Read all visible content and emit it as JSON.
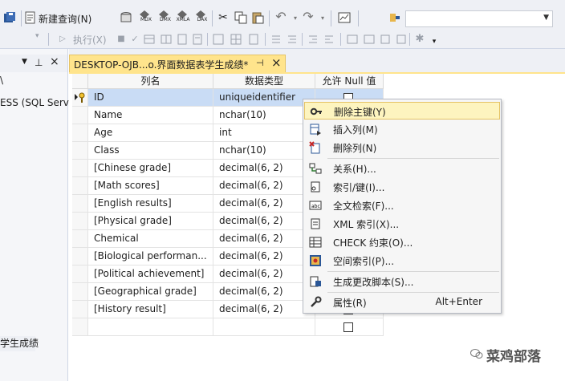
{
  "toolbar1": {
    "new_query_label": "新建查询(N)",
    "mini_labels": [
      "MDX",
      "DMX",
      "XMLA",
      "DAX"
    ]
  },
  "toolbar2": {
    "execute_label": "执行(X)"
  },
  "left_panel": {
    "server_fragment": "ESS (SQL Serv",
    "table_fragment": "学生成绩",
    "edge_char": "\\"
  },
  "document_tab": {
    "title": "DESKTOP-OJB...o.界面数据表学生成绩*"
  },
  "grid": {
    "headers": [
      "列名",
      "数据类型",
      "允许 Null 值"
    ],
    "rows": [
      {
        "name": "ID",
        "type": "uniqueidentifier",
        "allow_null": false,
        "primary_key": true
      },
      {
        "name": "Name",
        "type": "nchar(10)",
        "allow_null": false
      },
      {
        "name": "Age",
        "type": "int",
        "allow_null": false
      },
      {
        "name": "Class",
        "type": "nchar(10)",
        "allow_null": false
      },
      {
        "name": "[Chinese grade]",
        "type": "decimal(6, 2)",
        "allow_null": false
      },
      {
        "name": "[Math scores]",
        "type": "decimal(6, 2)",
        "allow_null": false
      },
      {
        "name": "[English results]",
        "type": "decimal(6, 2)",
        "allow_null": false
      },
      {
        "name": "[Physical grade]",
        "type": "decimal(6, 2)",
        "allow_null": false
      },
      {
        "name": "Chemical",
        "type": "decimal(6, 2)",
        "allow_null": false
      },
      {
        "name": "[Biological performan...",
        "type": "decimal(6, 2)",
        "allow_null": false
      },
      {
        "name": "[Political achievement]",
        "type": "decimal(6, 2)",
        "allow_null": false
      },
      {
        "name": "[Geographical grade]",
        "type": "decimal(6, 2)",
        "allow_null": false
      },
      {
        "name": "[History result]",
        "type": "decimal(6, 2)",
        "allow_null": false
      },
      {
        "name": "",
        "type": "",
        "allow_null": false
      }
    ]
  },
  "context_menu": {
    "items": [
      {
        "label": "删除主键(Y)",
        "icon": "key-icon"
      },
      {
        "label": "插入列(M)",
        "icon": "insert-column-icon"
      },
      {
        "label": "删除列(N)",
        "icon": "delete-column-icon"
      },
      {
        "label": "关系(H)...",
        "icon": "relationship-icon"
      },
      {
        "label": "索引/键(I)...",
        "icon": "index-icon"
      },
      {
        "label": "全文检索(F)...",
        "icon": "fulltext-icon"
      },
      {
        "label": "XML 索引(X)...",
        "icon": "xml-index-icon"
      },
      {
        "label": "CHECK 约束(O)...",
        "icon": "check-constraint-icon"
      },
      {
        "label": "空间索引(P)...",
        "icon": "spatial-index-icon"
      },
      {
        "label": "生成更改脚本(S)...",
        "icon": "script-icon"
      },
      {
        "label": "属性(R)",
        "icon": "wrench-icon",
        "shortcut": "Alt+Enter"
      }
    ]
  },
  "watermark": {
    "text": "菜鸡部落"
  },
  "colors": {
    "chrome": "#eef0f5",
    "tab_active": "#ffe48c",
    "row_selected": "#c9dcf5",
    "menu_highlight": "#fdf4bf"
  }
}
